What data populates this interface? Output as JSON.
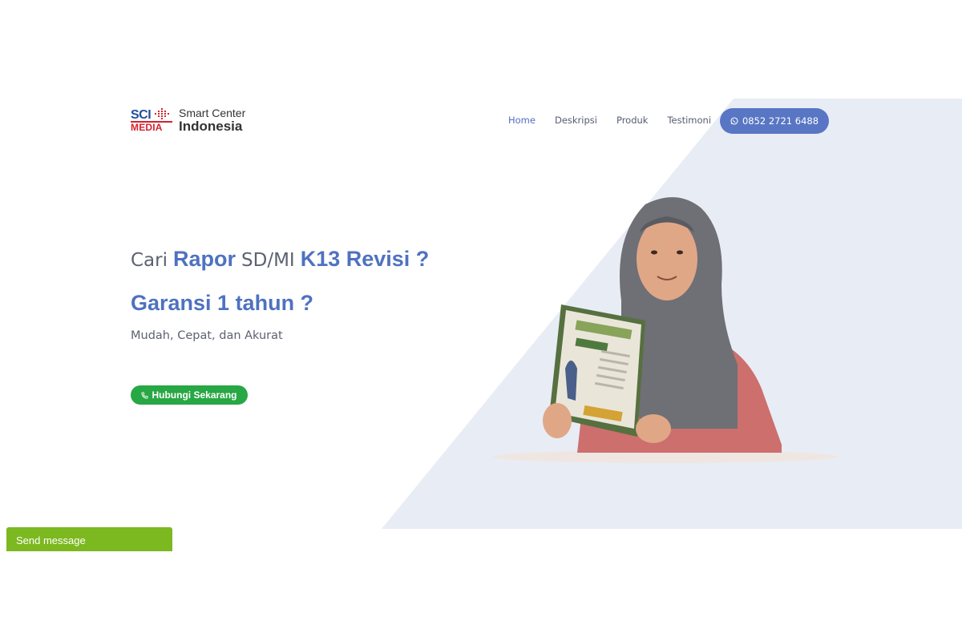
{
  "logo": {
    "mark_top": "SCI",
    "mark_bottom": "MEDIA",
    "line1": "Smart Center",
    "line2": "Indonesia"
  },
  "nav": {
    "items": [
      {
        "label": "Home",
        "active": true
      },
      {
        "label": "Deskripsi",
        "active": false
      },
      {
        "label": "Produk",
        "active": false
      },
      {
        "label": "Testimoni",
        "active": false
      }
    ],
    "phone_button": {
      "label": "0852 2721 6488",
      "icon": "whatsapp-icon"
    }
  },
  "hero": {
    "line1": {
      "part1": "Cari",
      "part2": "Rapor",
      "part3": "SD/MI",
      "part4": "K13 Revisi ?"
    },
    "line2": "Garansi 1 tahun ?",
    "subtitle": "Mudah, Cepat, dan Akurat",
    "cta": {
      "label": "Hubungi Sekarang",
      "icon": "phone-icon"
    }
  },
  "widget": {
    "send_message": "Send message"
  },
  "colors": {
    "accent": "#4f72c0",
    "nav_button": "#5876c4",
    "cta": "#28a745",
    "send_message": "#7cb81f",
    "bg_shape": "#e8ecf5"
  }
}
